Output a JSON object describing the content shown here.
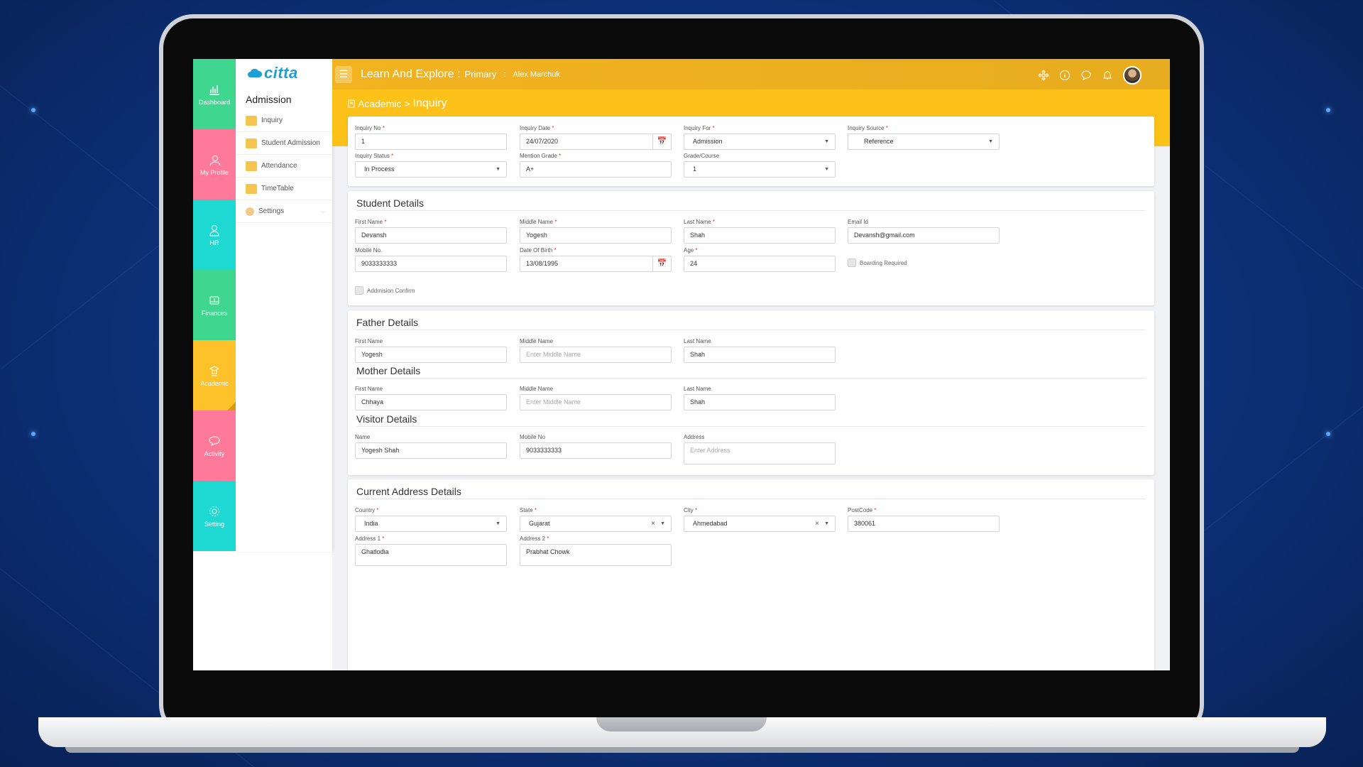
{
  "app": {
    "title": "Learn And Explore :",
    "branch": "Primary",
    "separator": ":",
    "user": "Alex Marchuk"
  },
  "page": {
    "breadcrumb_parent": "Academic >",
    "breadcrumb_current": "Inquiry"
  },
  "rail": [
    {
      "label": "Dashboard",
      "icon": "dashboard-icon",
      "color": "#3fd68f"
    },
    {
      "label": "My Profile",
      "icon": "profile-icon",
      "color": "#ff7a9a"
    },
    {
      "label": "HR",
      "icon": "hr-icon",
      "color": "#1ed9d2"
    },
    {
      "label": "Finances",
      "icon": "finances-icon",
      "color": "#3fd68f"
    },
    {
      "label": "Academic",
      "icon": "academic-icon",
      "color": "#fdc22a"
    },
    {
      "label": "Activity",
      "icon": "activity-icon",
      "color": "#ff7a9a"
    },
    {
      "label": "Setting",
      "icon": "setting-icon",
      "color": "#1ed9d2"
    }
  ],
  "logo": {
    "text": "citta"
  },
  "sidemenu": {
    "title": "Admission",
    "items": [
      "Inquiry",
      "Student Admission",
      "Attendance",
      "TimeTable",
      "Settings"
    ]
  },
  "inquiry": {
    "inquiry_no": {
      "label": "Inquiry No",
      "value": "1"
    },
    "inquiry_date": {
      "label": "Inquiry Date",
      "value": "24/07/2020"
    },
    "inquiry_for": {
      "label": "Inquiry For",
      "value": "Admission"
    },
    "inquiry_source": {
      "label": "Inquiry Source",
      "value": "Reference"
    },
    "inquiry_status": {
      "label": "Inquiry Status",
      "value": "In Process"
    },
    "mention_grade": {
      "label": "Mention Grade",
      "value": "A+"
    },
    "grade_course": {
      "label": "Grade/Course",
      "value": "1"
    }
  },
  "student": {
    "title": "Student Details",
    "first_name": {
      "label": "First Name",
      "value": "Devansh"
    },
    "middle_name": {
      "label": "Middle Name",
      "value": "Yogesh"
    },
    "last_name": {
      "label": "Last Name",
      "value": "Shah"
    },
    "email": {
      "label": "Email Id",
      "value": "Devansh@gmail.com"
    },
    "mobile": {
      "label": "Mobile No.",
      "value": "9033333333"
    },
    "dob": {
      "label": "Date Of Birth",
      "value": "13/08/1995"
    },
    "age": {
      "label": "Age",
      "value": "24"
    },
    "boarding_label": "Boarding Required",
    "admission_confirm_label": "Addmision Confirm"
  },
  "father": {
    "title": "Father Details",
    "first_name": {
      "label": "First Name",
      "value": "Yogesh"
    },
    "middle_name": {
      "label": "Middle Name",
      "placeholder": "Enter Middle Name"
    },
    "last_name": {
      "label": "Last Name",
      "value": "Shah"
    }
  },
  "mother": {
    "title": "Mother Details",
    "first_name": {
      "label": "First Name",
      "value": "Chhaya"
    },
    "middle_name": {
      "label": "Middle Name",
      "placeholder": "Enter Middle Name"
    },
    "last_name": {
      "label": "Last Name",
      "value": "Shah"
    }
  },
  "visitor": {
    "title": "Visitor Details",
    "name": {
      "label": "Name",
      "value": "Yogesh Shah"
    },
    "mobile": {
      "label": "Mobile No",
      "value": "9033333333"
    },
    "address": {
      "label": "Address",
      "placeholder": "Enter Address"
    }
  },
  "address": {
    "title": "Current Address Details",
    "country": {
      "label": "Country",
      "value": "India"
    },
    "state": {
      "label": "State",
      "value": "Gujarat"
    },
    "city": {
      "label": "City",
      "value": "Ahmedabad"
    },
    "postcode": {
      "label": "PostCode",
      "value": "380061"
    },
    "address1": {
      "label": "Address 1",
      "value": "Ghatlodia"
    },
    "address2": {
      "label": "Address 2",
      "value": "Prabhat Chowk"
    }
  },
  "symbols": {
    "required": "*",
    "dropdown": "▼",
    "clear": "×",
    "calendar": "📅",
    "chevron": "⌵",
    "hamburger": "☰"
  }
}
